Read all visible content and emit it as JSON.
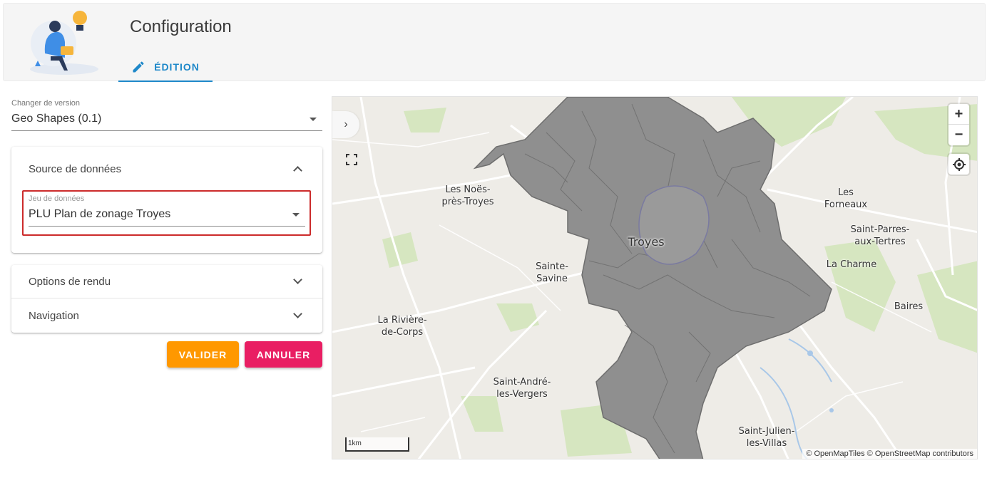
{
  "header": {
    "title": "Configuration",
    "tab_edit_label": "ÉDITION"
  },
  "version_select": {
    "label": "Changer de version",
    "value": "Geo Shapes (0.1)"
  },
  "source_panel": {
    "title": "Source de données",
    "dataset_label": "Jeu de données",
    "dataset_value": "PLU Plan de zonage Troyes"
  },
  "accordion": {
    "render_options": "Options de rendu",
    "navigation": "Navigation"
  },
  "actions": {
    "validate": "VALIDER",
    "cancel": "ANNULER"
  },
  "map": {
    "zoom_in": "+",
    "zoom_out": "−",
    "toggle_panel": "›",
    "scale": "1km",
    "attribution": "© OpenMapTiles © OpenStreetMap contributors",
    "places": {
      "noes": "Les Noës-\nprès-Troyes",
      "troyes": "Troyes",
      "sainte_savine": "Sainte-\nSavine",
      "riviere": "La Rivière-\nde-Corps",
      "saint_andre": "Saint-André-\nles-Vergers",
      "fourneaux": "Les\nForneaux",
      "saint_parres": "Saint-Parres-\naux-Tertres",
      "la_charme": "La Charme",
      "baires": "Baires",
      "saint_julien": "Saint-Julien-\nles-Villas"
    }
  },
  "colors": {
    "accent": "#1e88c9",
    "validate": "#ff9800",
    "cancel": "#e91e63",
    "highlight": "#cc2b2b",
    "zone_fill": "#8f8f8f"
  }
}
